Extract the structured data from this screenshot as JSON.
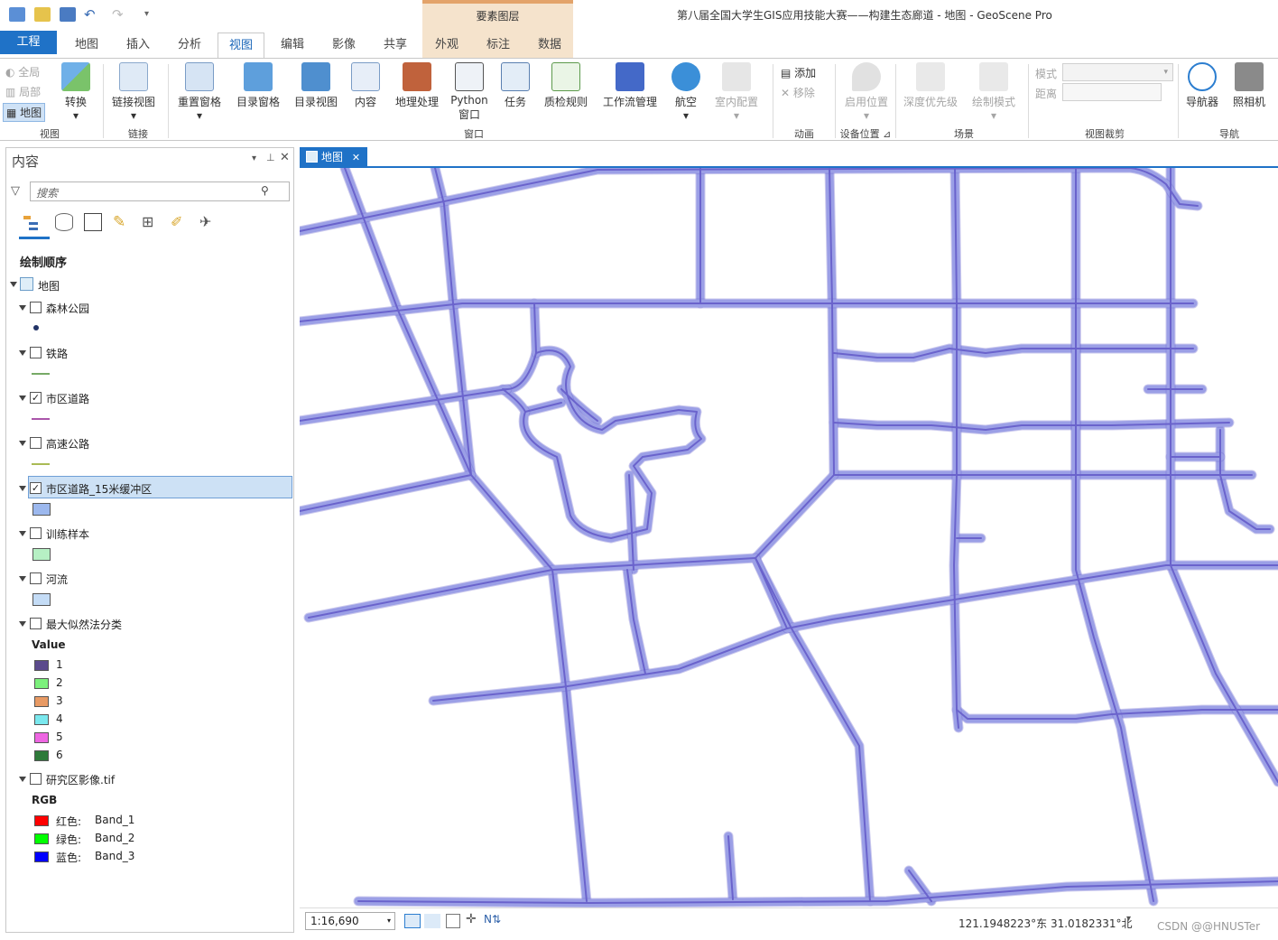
{
  "window": {
    "title": "第八届全国大学生GIS应用技能大赛——构建生态廊道 - 地图 - GeoScene Pro",
    "context_tab_group": "要素图层"
  },
  "tabs": [
    "工程",
    "地图",
    "插入",
    "分析",
    "视图",
    "编辑",
    "影像",
    "共享",
    "外观",
    "标注",
    "数据"
  ],
  "active_tab": "视图",
  "ribbon": {
    "view_group": {
      "full": "全局",
      "local": "局部",
      "map": "地图",
      "convert": "转换",
      "label": "视图"
    },
    "link_group": {
      "link_views": "链接视图",
      "label": "链接"
    },
    "window_group": {
      "reset_panes": "重置窗格",
      "catalog_pane": "目录窗格",
      "catalog_view": "目录视图",
      "contents": "内容",
      "geoprocessing": "地理处理",
      "python_line1": "Python",
      "python_line2": "窗口",
      "tasks": "任务",
      "qa_rules": "质检规则",
      "workflow": "工作流管理",
      "fly": "航空",
      "indoor": "室内配置",
      "label": "窗口"
    },
    "animation_group": {
      "add": "添加",
      "remove": "移除",
      "label": "动画"
    },
    "device_group": {
      "enable_location": "启用位置",
      "label": "设备位置"
    },
    "scene_group": {
      "depth_priority": "深度优先级",
      "draw_mode": "绘制模式",
      "label": "场景"
    },
    "clip_group": {
      "mode": "模式",
      "distance": "距离",
      "label": "视图裁剪"
    },
    "nav_group": {
      "navigator": "导航器",
      "camera": "照相机",
      "label": "导航"
    }
  },
  "contents_pane": {
    "title": "内容",
    "search_placeholder": "搜索",
    "drawing_order": "绘制顺序",
    "map_name": "地图",
    "layers": [
      {
        "name": "森林公园",
        "checked": false
      },
      {
        "name": "铁路",
        "checked": false
      },
      {
        "name": "市区道路",
        "checked": true
      },
      {
        "name": "高速公路",
        "checked": false
      },
      {
        "name": "市区道路_15米缓冲区",
        "checked": true
      },
      {
        "name": "训练样本",
        "checked": false
      },
      {
        "name": "河流",
        "checked": false
      },
      {
        "name": "最大似然法分类",
        "checked": false
      },
      {
        "name": "研究区影像.tif",
        "checked": false
      }
    ],
    "classification": {
      "heading": "Value",
      "values": [
        {
          "label": "1",
          "color": "#5b4a8c"
        },
        {
          "label": "2",
          "color": "#7cf07c"
        },
        {
          "label": "3",
          "color": "#e89a64"
        },
        {
          "label": "4",
          "color": "#7ae8ee"
        },
        {
          "label": "5",
          "color": "#ee66e2"
        },
        {
          "label": "6",
          "color": "#2e7a3a"
        }
      ]
    },
    "rgb": {
      "heading": "RGB",
      "bands": [
        {
          "channel": "红色:",
          "band": "Band_1",
          "color": "#ff0000"
        },
        {
          "channel": "绿色:",
          "band": "Band_2",
          "color": "#00ff00"
        },
        {
          "channel": "蓝色:",
          "band": "Band_3",
          "color": "#0000ff"
        }
      ]
    },
    "symbols": {
      "forest": "#223366",
      "rail": "#77aa66",
      "road": "#aa55aa",
      "highway": "#aabb55",
      "buffer": "#9cb8ee",
      "training": "#b6f0c4",
      "river": "#c4dcf6"
    }
  },
  "map_view": {
    "tab_label": "地图",
    "scale": "1:16,690",
    "coordinates": "121.1948223°东 31.0182331°北",
    "watermark": "CSDN @@HNUSTer",
    "road_color": "#6a63cc",
    "road_halo": "#9b9fe6"
  }
}
